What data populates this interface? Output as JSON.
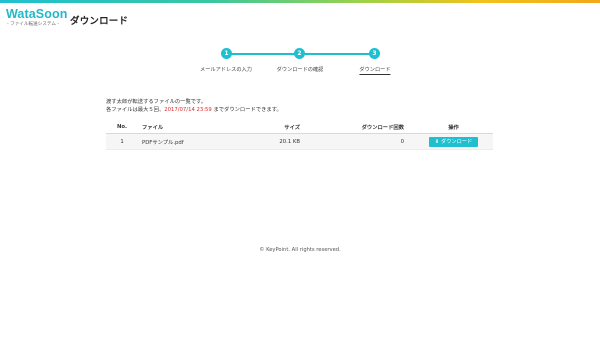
{
  "app": {
    "logo_text": "WataSoon",
    "logo_sub": "- ファイル転送システム -",
    "page_title": "ダウンロード"
  },
  "stepper": {
    "steps": [
      {
        "number": "1",
        "label": "メールアドレスの入力"
      },
      {
        "number": "2",
        "label": "ダウンロードの確認"
      },
      {
        "number": "3",
        "label": "ダウンロード"
      }
    ]
  },
  "description": {
    "line1": "渡す太郎が転送するファイルの一覧です。",
    "line2_prefix": "各ファイルは最大５回、",
    "line2_date": "2017/07/14 23:59",
    "line2_suffix": " までダウンロードできます。"
  },
  "table": {
    "headers": {
      "no": "No.",
      "file": "ファイル",
      "size": "サイズ",
      "downloads": "ダウンロード回数",
      "action": "操作"
    },
    "rows": [
      {
        "no": "1",
        "file": "PDFサンプル.pdf",
        "size": "20.1 KB",
        "downloads": "0",
        "action_label": "ダウンロード"
      }
    ]
  },
  "footer": {
    "text": "© KeyPoint. All rights reserved."
  },
  "colors": {
    "accent": "#1fbfcf",
    "date_highlight": "#e02b2b"
  },
  "icons": {
    "download": "download-icon"
  }
}
